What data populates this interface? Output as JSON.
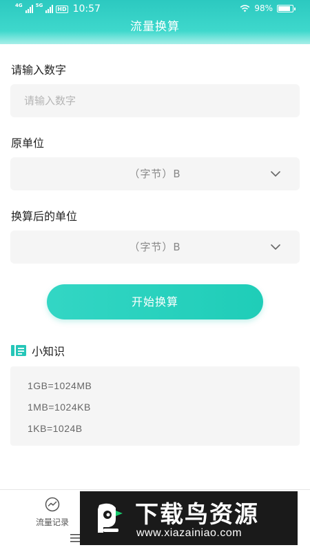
{
  "status_bar": {
    "signal_1_tag": "4G",
    "signal_2_tag": "5G",
    "hd_badge": "HD",
    "time": "10:57",
    "battery": "98%"
  },
  "header": {
    "title": "流量换算"
  },
  "form": {
    "number_label": "请输入数字",
    "number_placeholder": "请输入数字",
    "number_value": "",
    "source_unit_label": "原单位",
    "source_unit_value": "（字节）B",
    "target_unit_label": "换算后的单位",
    "target_unit_value": "（字节）B",
    "convert_button": "开始换算"
  },
  "tips": {
    "title": "小知识",
    "items": [
      "1GB=1024MB",
      "1MB=1024KB",
      "1KB=1024B"
    ]
  },
  "tabbar": {
    "items": [
      {
        "label": "流量记录",
        "icon": "chart-circle-icon"
      }
    ]
  },
  "watermark": {
    "brand": "下载鸟资源",
    "url": "www.xiazainiao.com"
  },
  "colors": {
    "accent": "#2ccfc0",
    "field_bg": "#f5f5f5",
    "header_gradient_top": "#2cc9c0"
  }
}
